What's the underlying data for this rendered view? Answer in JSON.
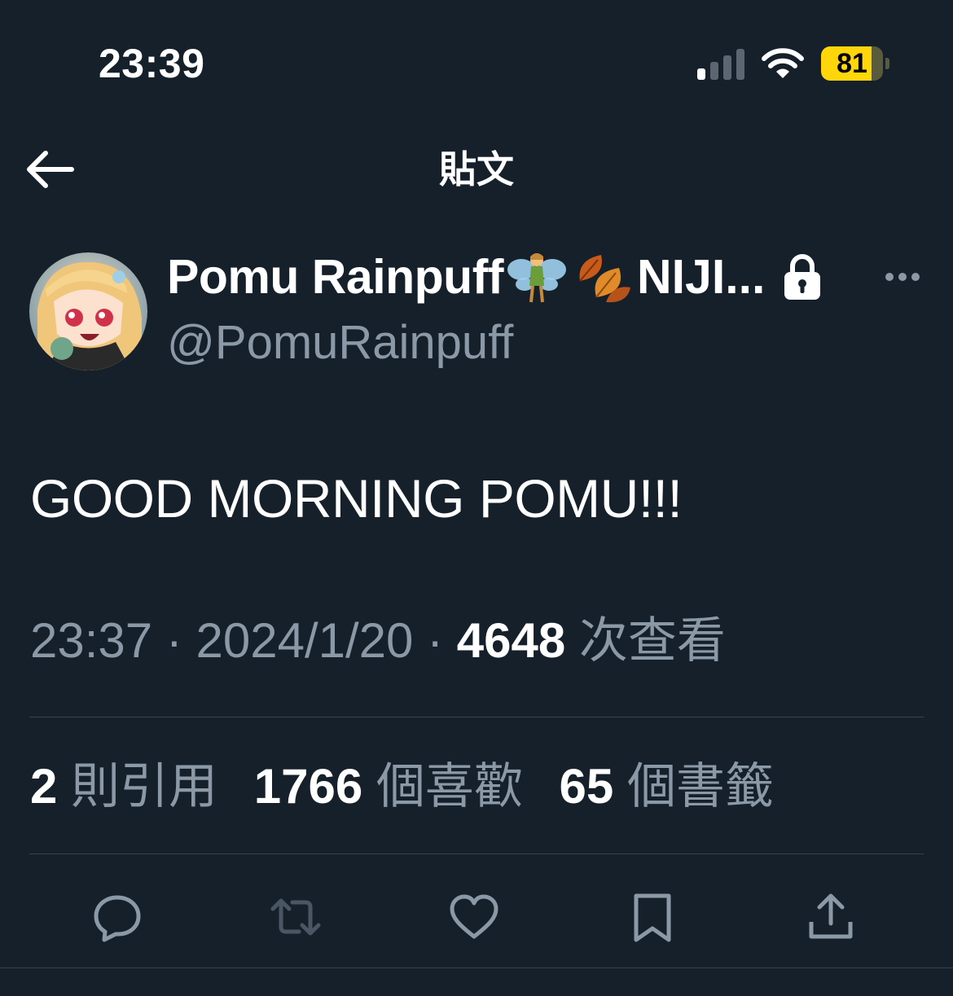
{
  "status_bar": {
    "time": "23:39",
    "battery_level": "81",
    "battery_fraction": 0.81,
    "signal_bars_active": 1,
    "signal_bars_total": 4
  },
  "header": {
    "title": "貼文",
    "back_icon": "arrow-left-icon"
  },
  "author": {
    "display_name": "Pomu Rainpuff",
    "name_suffix": "NIJI...",
    "name_emoji": [
      "fairy",
      "fallen-leaves"
    ],
    "handle": "@PomuRainpuff",
    "protected_icon": "lock-icon",
    "more_icon": "more-icon"
  },
  "post": {
    "text": "GOOD MORNING POMU!!!",
    "time": "23:37",
    "date": "2024/1/20",
    "views": "4648",
    "views_label": "次查看",
    "separator": "·"
  },
  "stats": [
    {
      "count": "2",
      "label": "則引用"
    },
    {
      "count": "1766",
      "label": "個喜歡"
    },
    {
      "count": "65",
      "label": "個書籤"
    }
  ],
  "actions": [
    "reply-icon",
    "repost-icon",
    "like-icon",
    "bookmark-icon",
    "share-icon"
  ],
  "colors": {
    "background": "#15202b",
    "text": "#ffffff",
    "secondary_text": "#8b98a5",
    "divider": "#38444d",
    "battery": "#ffd60a"
  }
}
